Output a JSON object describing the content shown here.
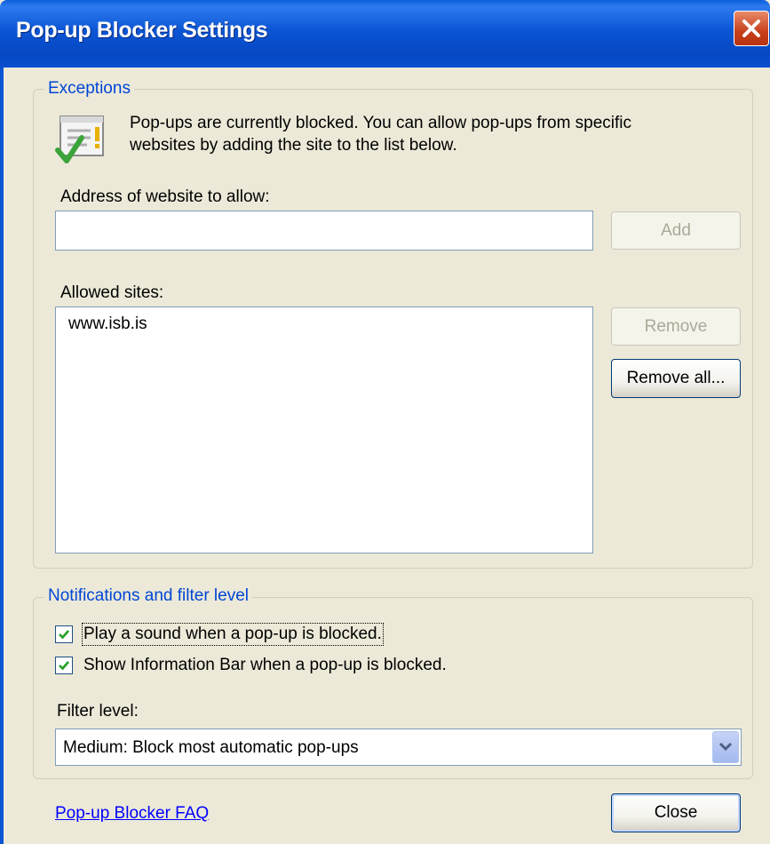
{
  "window": {
    "title": "Pop-up Blocker Settings"
  },
  "exceptions": {
    "legend": "Exceptions",
    "info_line1": "Pop-ups are currently blocked.  You can allow pop-ups from specific",
    "info_line2": "websites by adding the site to the list below.",
    "address_label": "Address of website to allow:",
    "address_value": "",
    "add_label": "Add",
    "allowed_label": "Allowed sites:",
    "allowed_sites": [
      "www.isb.is"
    ],
    "remove_label": "Remove",
    "remove_all_label": "Remove all..."
  },
  "notifications": {
    "legend": "Notifications and filter level",
    "play_sound_label": "Play a sound when a pop-up is blocked.",
    "play_sound_checked": true,
    "show_infobar_label": "Show Information Bar when a pop-up is blocked.",
    "show_infobar_checked": true,
    "filter_label": "Filter level:",
    "filter_value": "Medium: Block most automatic pop-ups"
  },
  "footer": {
    "faq_link": "Pop-up Blocker FAQ",
    "close_label": "Close"
  },
  "colors": {
    "titlebar": "#0b55d4",
    "legend": "#0046d5",
    "face": "#ece9d8"
  }
}
